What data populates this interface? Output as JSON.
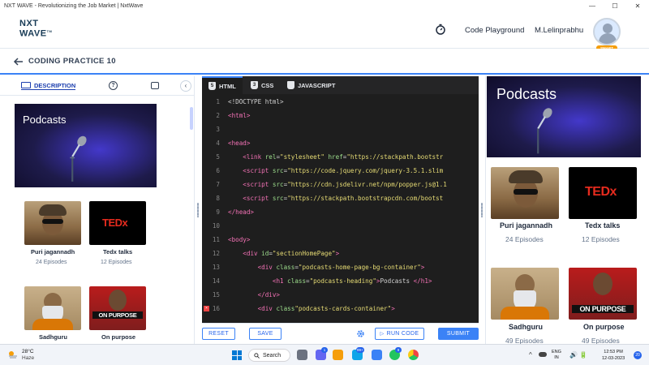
{
  "window": {
    "title": "NXT WAVE - Revolutionizing the Job Market | NxtWave",
    "controls": [
      "—",
      "☐",
      "✕"
    ]
  },
  "header": {
    "logo_top": "NXT",
    "logo_bottom": "WAVE",
    "logo_tm": "TM",
    "code_playground": "Code Playground",
    "username": "M.Lelinprabhu",
    "avatar_badge": "SMART"
  },
  "subheader": {
    "title": "CODING PRACTICE 10"
  },
  "left_panel": {
    "tab_description": "DESCRIPTION",
    "tab_help": "?",
    "collapse": "‹",
    "banner_title": "Podcasts",
    "cards": [
      {
        "name": "Puri jagannadh",
        "episodes": "24 Episodes"
      },
      {
        "name": "Tedx talks",
        "episodes": "12 Episodes"
      },
      {
        "name": "Sadhguru",
        "episodes": ""
      },
      {
        "name": "On purpose",
        "episodes": ""
      }
    ],
    "tedx_logo": "TEDx",
    "onpurpose_logo": "ON PURPOSE"
  },
  "editor": {
    "tabs": [
      {
        "label": "HTML",
        "badge": "5"
      },
      {
        "label": "CSS",
        "badge": "3"
      },
      {
        "label": "JAVASCRIPT",
        "badge": ""
      }
    ],
    "lines": [
      {
        "n": "1",
        "html": "&lt;!DOCTYPE html&gt;"
      },
      {
        "n": "2",
        "html": "<span class='tag'>&lt;html&gt;</span>"
      },
      {
        "n": "3",
        "html": ""
      },
      {
        "n": "4",
        "html": "<span class='tag'>&lt;head&gt;</span>"
      },
      {
        "n": "5",
        "html": "    <span class='tag'>&lt;link</span> <span class='attr'>rel</span>=<span class='str'>\"stylesheet\"</span> <span class='attr'>href</span>=<span class='str'>\"https://stackpath.bootstr</span>"
      },
      {
        "n": "6",
        "html": "    <span class='tag'>&lt;script</span> <span class='attr'>src</span>=<span class='str'>\"https://code.jquery.com/jquery-3.5.1.slim</span>"
      },
      {
        "n": "7",
        "html": "    <span class='tag'>&lt;script</span> <span class='attr'>src</span>=<span class='str'>\"https://cdn.jsdelivr.net/npm/popper.js@1.1</span>"
      },
      {
        "n": "8",
        "html": "    <span class='tag'>&lt;script</span> <span class='attr'>src</span>=<span class='str'>\"https://stackpath.bootstrapcdn.com/bootst</span>"
      },
      {
        "n": "9",
        "html": "<span class='tag'>&lt;/head&gt;</span>"
      },
      {
        "n": "10",
        "html": ""
      },
      {
        "n": "11",
        "html": "<span class='tag'>&lt;body&gt;</span>"
      },
      {
        "n": "12",
        "html": "    <span class='tag'>&lt;div</span> <span class='attr'>id</span>=<span class='str'>\"sectionHomePage\"</span><span class='tag'>&gt;</span>"
      },
      {
        "n": "13",
        "html": "        <span class='tag'>&lt;div</span> <span class='attr'>class</span>=<span class='str'>\"podcasts-home-page-bg-container\"</span><span class='tag'>&gt;</span>"
      },
      {
        "n": "14",
        "html": "            <span class='tag'>&lt;h1</span> <span class='attr'>class</span>=<span class='str'>\"podcasts-heading\"</span><span class='tag'>&gt;</span>Podcasts <span class='tag'>&lt;/h1&gt;</span>"
      },
      {
        "n": "15",
        "html": "        <span class='tag'>&lt;/div&gt;</span>"
      },
      {
        "n": "16",
        "html": "        <span class='tag'>&lt;div</span> <span class='attr'>class</span><span class='str'>\"podcasts-cards-container\"</span><span class='tag'>&gt;</span>",
        "error": true
      }
    ],
    "buttons": {
      "reset": "RESET",
      "save": "SAVE",
      "run": "RUN CODE",
      "submit": "SUBMIT"
    }
  },
  "preview": {
    "banner_title": "Podcasts",
    "cards": [
      {
        "name": "Puri jagannadh",
        "episodes": "24 Episodes"
      },
      {
        "name": "Tedx talks",
        "episodes": "12 Episodes"
      },
      {
        "name": "Sadhguru",
        "episodes": "49 Episodes"
      },
      {
        "name": "On purpose",
        "episodes": "49 Episodes"
      }
    ],
    "tedx_logo": "TEDx",
    "onpurpose_logo": "ON PURPOSE"
  },
  "taskbar": {
    "weather_temp": "28°C",
    "weather_desc": "Haze",
    "search": "Search",
    "badge_1": "1",
    "badge_2": "99+",
    "badge_3": "9",
    "chevron": "^",
    "lang_top": "ENG",
    "lang_bottom": "IN",
    "sys_icons": "🔊🔋",
    "time": "12:53 PM",
    "date": "12-03-2023",
    "notifications": "20"
  },
  "colors": {
    "accent": "#3b82f6",
    "editor_bg": "#1e1e1e",
    "tedx_red": "#e62b1e"
  }
}
